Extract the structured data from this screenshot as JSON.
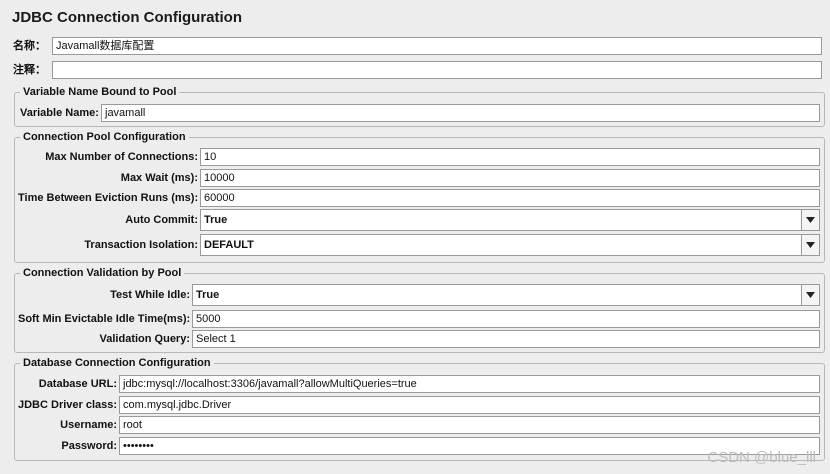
{
  "title": "JDBC Connection Configuration",
  "name_row": {
    "label": "名称：",
    "value": "Javamall数据库配置"
  },
  "comment_row": {
    "label": "注释：",
    "value": ""
  },
  "variable_group": {
    "legend": "Variable Name Bound to Pool",
    "variable_name_label": "Variable Name:",
    "variable_name_value": "javamall"
  },
  "pool_group": {
    "legend": "Connection Pool Configuration",
    "max_connections_label": "Max Number of Connections:",
    "max_connections_value": "10",
    "max_wait_label": "Max Wait (ms):",
    "max_wait_value": "10000",
    "eviction_label": "Time Between Eviction Runs (ms):",
    "eviction_value": "60000",
    "auto_commit_label": "Auto Commit:",
    "auto_commit_value": "True",
    "isolation_label": "Transaction Isolation:",
    "isolation_value": "DEFAULT"
  },
  "validation_group": {
    "legend": "Connection Validation by Pool",
    "test_idle_label": "Test While Idle:",
    "test_idle_value": "True",
    "soft_min_label": "Soft Min Evictable Idle Time(ms):",
    "soft_min_value": "5000",
    "query_label": "Validation Query:",
    "query_value": "Select 1"
  },
  "database_group": {
    "legend": "Database Connection Configuration",
    "url_label": "Database URL:",
    "url_value": "jdbc:mysql://localhost:3306/javamall?allowMultiQueries=true",
    "driver_label": "JDBC Driver class:",
    "driver_value": "com.mysql.jdbc.Driver",
    "username_label": "Username:",
    "username_value": "root",
    "password_label": "Password:",
    "password_value": "••••••••"
  },
  "watermark": "CSDN @blue_lll",
  "icons": {
    "dropdown": "chevron-down-icon"
  },
  "colors": {
    "background": "#ededed",
    "field_border": "#9a9a9a",
    "group_border": "#b8b8b8"
  }
}
